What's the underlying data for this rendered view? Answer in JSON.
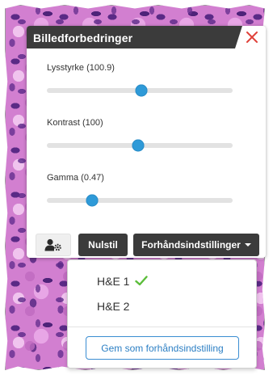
{
  "panel": {
    "title": "Billedforbedringer",
    "close_icon": "close-icon",
    "close_color": "#e0423b"
  },
  "sliders": [
    {
      "label": "Lysstyrke (100.9)",
      "level_fraction": 0.51
    },
    {
      "label": "Kontrast (100)",
      "level_fraction": 0.49
    },
    {
      "label": "Gamma (0.47)",
      "level_fraction": 0.245
    }
  ],
  "toolbar": {
    "settings_icon": "user-settings-icon",
    "reset_label": "Nulstil",
    "presets_label": "Forhåndsindstillinger"
  },
  "presets_menu": {
    "items": [
      {
        "label": "H&E 1",
        "selected": true
      },
      {
        "label": "H&E 2",
        "selected": false
      }
    ],
    "check_icon": "check-icon",
    "check_color": "#5bbd3a",
    "save_label": "Gem som forhåndsindstilling"
  },
  "colors": {
    "header_bg": "#3b3b3b",
    "accent": "#2e9ad8",
    "track": "#e2e2e2"
  }
}
